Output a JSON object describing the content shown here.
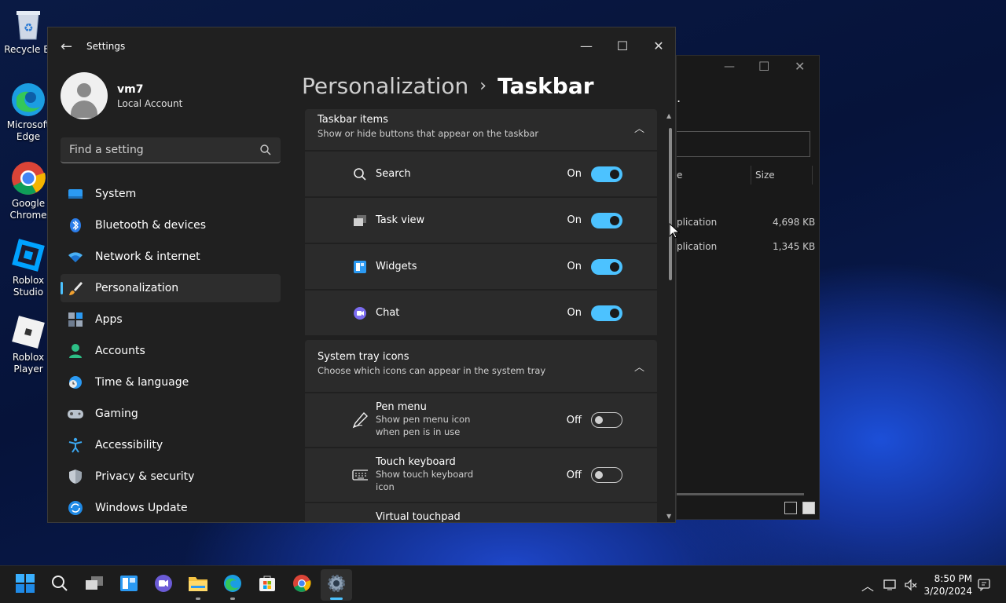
{
  "desktop": {
    "icons": [
      {
        "label": "Recycle Bi",
        "icon": "recycle-bin-icon"
      },
      {
        "label": "Microsoft Edge",
        "icon": "edge-icon"
      },
      {
        "label": "Google Chrome",
        "icon": "chrome-icon"
      },
      {
        "label": "Roblox Studio",
        "icon": "roblox-studio-icon"
      },
      {
        "label": "Roblox Player",
        "icon": "roblox-player-icon"
      }
    ]
  },
  "explorer": {
    "header_partial": "e",
    "col_size": "Size",
    "dot": ".",
    "rows": [
      {
        "type": "plication",
        "size": "4,698 KB"
      },
      {
        "type": "plication",
        "size": "1,345 KB"
      }
    ]
  },
  "settings": {
    "title": "Settings",
    "profile": {
      "name": "vm7",
      "type": "Local Account"
    },
    "search_placeholder": "Find a setting",
    "nav": [
      {
        "label": "System",
        "icon": "system-icon"
      },
      {
        "label": "Bluetooth & devices",
        "icon": "bluetooth-icon"
      },
      {
        "label": "Network & internet",
        "icon": "network-icon"
      },
      {
        "label": "Personalization",
        "icon": "brush-icon",
        "selected": true
      },
      {
        "label": "Apps",
        "icon": "apps-icon"
      },
      {
        "label": "Accounts",
        "icon": "accounts-icon"
      },
      {
        "label": "Time & language",
        "icon": "time-language-icon"
      },
      {
        "label": "Gaming",
        "icon": "gaming-icon"
      },
      {
        "label": "Accessibility",
        "icon": "accessibility-icon"
      },
      {
        "label": "Privacy & security",
        "icon": "shield-icon"
      },
      {
        "label": "Windows Update",
        "icon": "windows-update-icon"
      }
    ],
    "breadcrumb": {
      "parent": "Personalization",
      "current": "Taskbar"
    },
    "taskbar_items": {
      "title": "Taskbar items",
      "subtitle": "Show or hide buttons that appear on the taskbar",
      "items": [
        {
          "label": "Search",
          "state": "On",
          "on": true,
          "icon": "search-icon"
        },
        {
          "label": "Task view",
          "state": "On",
          "on": true,
          "icon": "task-view-icon"
        },
        {
          "label": "Widgets",
          "state": "On",
          "on": true,
          "icon": "widgets-icon"
        },
        {
          "label": "Chat",
          "state": "On",
          "on": true,
          "icon": "chat-icon"
        }
      ]
    },
    "tray_icons": {
      "title": "System tray icons",
      "subtitle": "Choose which icons can appear in the system tray",
      "items": [
        {
          "label": "Pen menu",
          "desc": "Show pen menu icon when pen is in use",
          "state": "Off",
          "on": false,
          "icon": "pen-icon"
        },
        {
          "label": "Touch keyboard",
          "desc": "Show touch keyboard icon",
          "state": "Off",
          "on": false,
          "icon": "keyboard-icon"
        },
        {
          "label": "Virtual touchpad",
          "desc": "",
          "state": "",
          "on": false,
          "icon": "touchpad-icon"
        }
      ]
    }
  },
  "taskbar": {
    "apps": [
      "start-icon",
      "search-icon",
      "task-view-icon",
      "widgets-icon",
      "chat-icon",
      "file-explorer-icon",
      "edge-icon",
      "store-icon",
      "chrome-icon",
      "settings-icon"
    ],
    "time": "8:50 PM",
    "date": "3/20/2024"
  },
  "colors": {
    "accent": "#4cc2ff",
    "window_bg": "#202020",
    "card_bg": "#2b2b2b"
  }
}
